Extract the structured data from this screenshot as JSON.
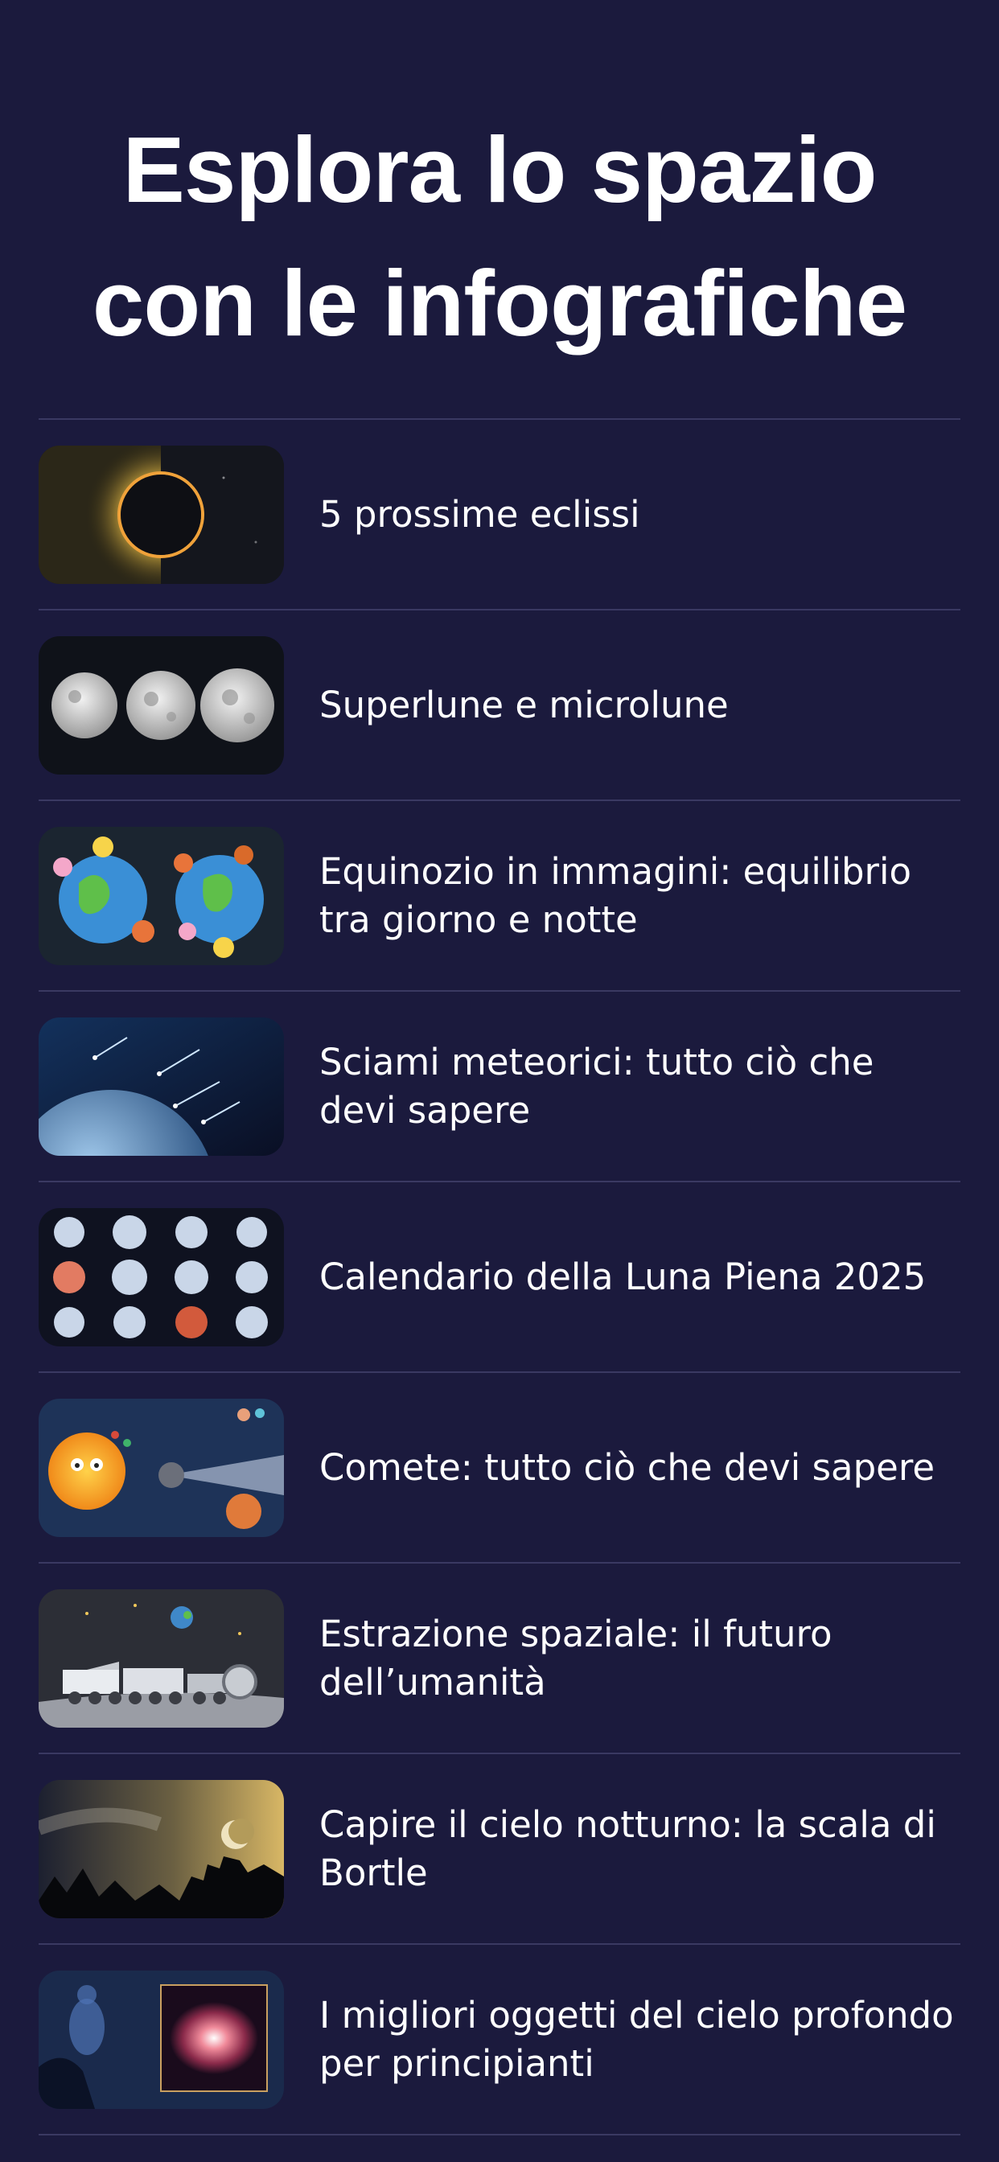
{
  "header": {
    "title_line1": "Esplora lo spazio",
    "title_line2": "con le infografiche"
  },
  "items": [
    {
      "label": "5 prossime eclissi",
      "icon": "eclipse-icon"
    },
    {
      "label": "Superlune e microlune",
      "icon": "moons-icon"
    },
    {
      "label": "Equinozio in immagini: equilibrio tra giorno e notte",
      "icon": "earth-seasons-icon"
    },
    {
      "label": "Sciami meteorici: tutto ciò che devi sapere",
      "icon": "meteor-shower-icon"
    },
    {
      "label": "Calendario della Luna Piena 2025",
      "icon": "full-moon-calendar-icon"
    },
    {
      "label": "Comete: tutto ciò che devi sapere",
      "icon": "comet-icon"
    },
    {
      "label": "Estrazione spaziale: il futuro dell’umanità",
      "icon": "space-mining-icon"
    },
    {
      "label": "Capire il cielo notturno: la scala di Bortle",
      "icon": "night-sky-icon"
    },
    {
      "label": "I migliori oggetti del cielo profondo per principianti",
      "icon": "deep-sky-icon"
    }
  ]
}
